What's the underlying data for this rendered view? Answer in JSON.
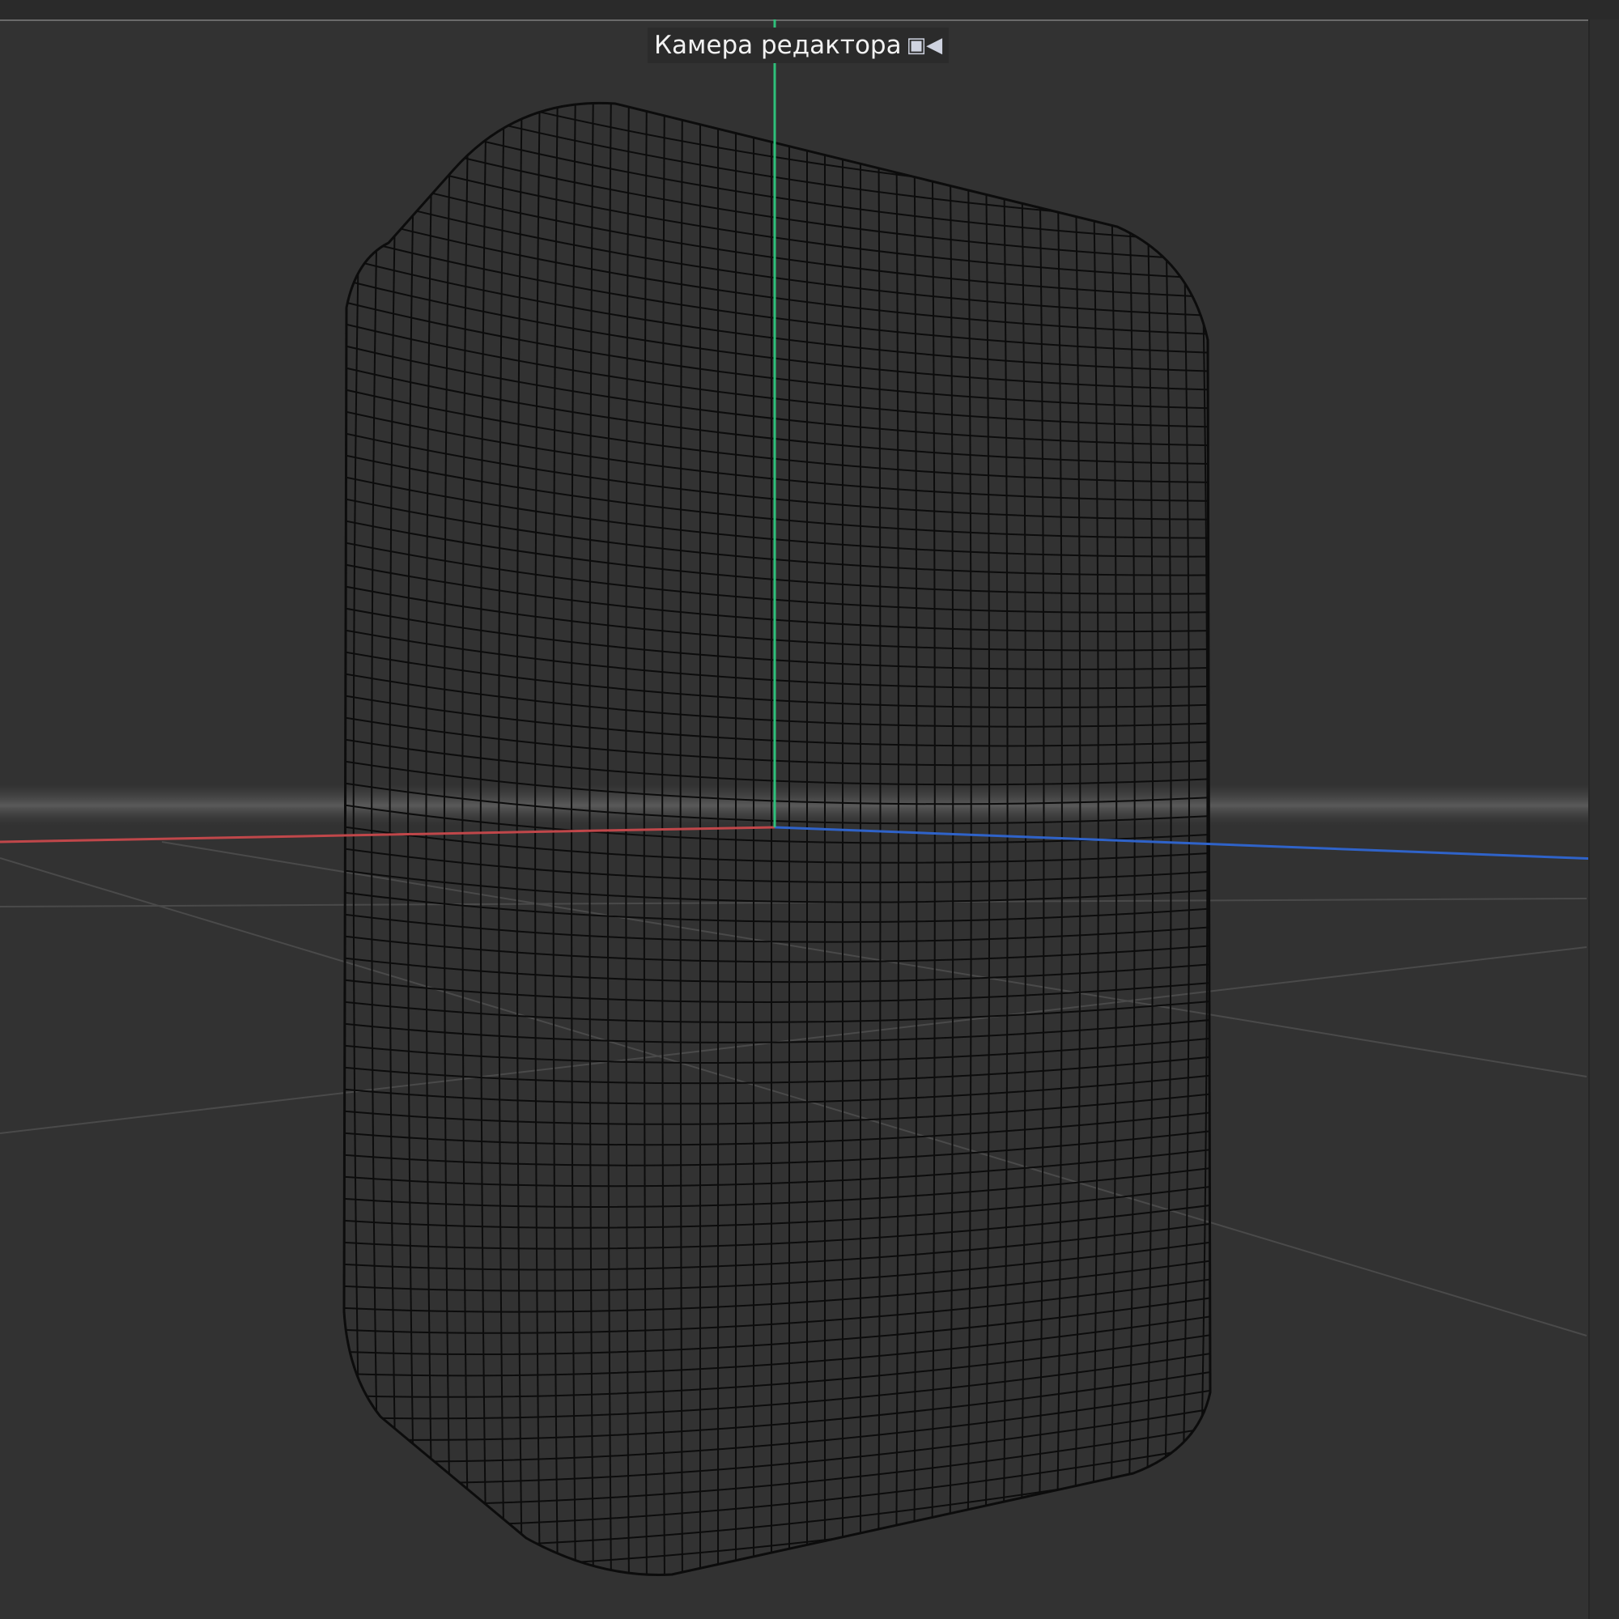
{
  "viewport": {
    "camera_label": "Камера редактора",
    "camera_icon": "camera-icon"
  },
  "colors": {
    "background": "#323232",
    "axis_x": "#c0474a",
    "axis_y": "#2ec07a",
    "axis_z": "#2f63c9",
    "wireframe": "#0c0c0c"
  }
}
